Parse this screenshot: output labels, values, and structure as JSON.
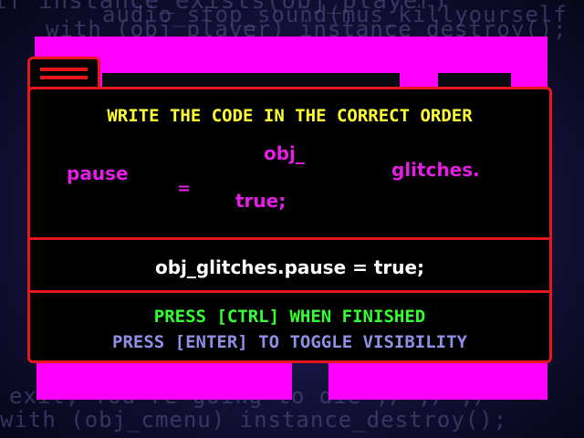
{
  "background_code": {
    "line1": "if instance_exists(obj_player)",
    "line2": "audio_stop_sound(mus_killyourself",
    "line3": "with (obj_player) instance_destroy();",
    "line4": "exit; You're going to die ;/ ;/ ;/",
    "line5": "with (obj_cmenu) instance_destroy();"
  },
  "puzzle": {
    "title": "WRITE THE CODE IN THE CORRECT ORDER",
    "tokens": {
      "obj": "obj_",
      "pause": "pause",
      "glitches": "glitches.",
      "equals": "=",
      "true": "true;"
    },
    "answer": "obj_glitches.pause = true;",
    "hint_finish": "PRESS [CTRL] WHEN FINISHED",
    "hint_toggle": "PRESS [ENTER] TO TOGGLE VISIBILITY"
  },
  "colors": {
    "border": "#e8171d",
    "magenta": "#ff00ff",
    "title": "#ffff33",
    "token": "#e51ee5",
    "answer": "#ffffff",
    "hint_finish": "#33ff33",
    "hint_toggle": "#8f8fe6"
  }
}
